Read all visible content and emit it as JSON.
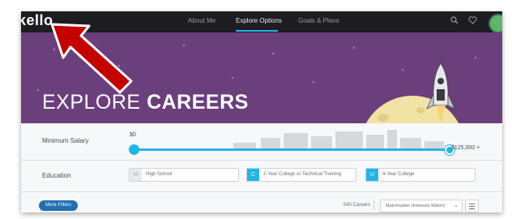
{
  "app": {
    "logo": "kello"
  },
  "nav": {
    "items": [
      {
        "label": "About Me"
      },
      {
        "label": "Explore Options"
      },
      {
        "label": "Goals & Plans"
      }
    ],
    "active": "Explore Options"
  },
  "hero": {
    "title_light": "EXPLORE ",
    "title_bold": "CAREERS"
  },
  "filters": {
    "salary": {
      "label": "Minimum Salary",
      "min_label": "$0",
      "max_label": "$125,000 +",
      "value_fraction": 0
    },
    "education": {
      "label": "Education",
      "options": [
        {
          "badge": "H",
          "label": "High School",
          "selected": false
        },
        {
          "badge": "C",
          "label": "2-Year College or Technical Training",
          "selected": true
        },
        {
          "badge": "U",
          "label": "4-Year College",
          "selected": true
        }
      ]
    },
    "more_filters_label": "More Filters",
    "career_count": "540 Careers",
    "sort_label": "Matchmaker (Interests Match)"
  },
  "colors": {
    "accent": "#23b5e8",
    "hero_bg": "#6b3f7c",
    "topbar_bg": "#1d1c20",
    "button_blue": "#1f6fb3",
    "arrow_red": "#c40000"
  },
  "icons": {
    "search": "search-icon",
    "heart": "heart-icon",
    "avatar": "avatar",
    "list": "list-view-icon",
    "chevron": "chevron-down-icon"
  }
}
